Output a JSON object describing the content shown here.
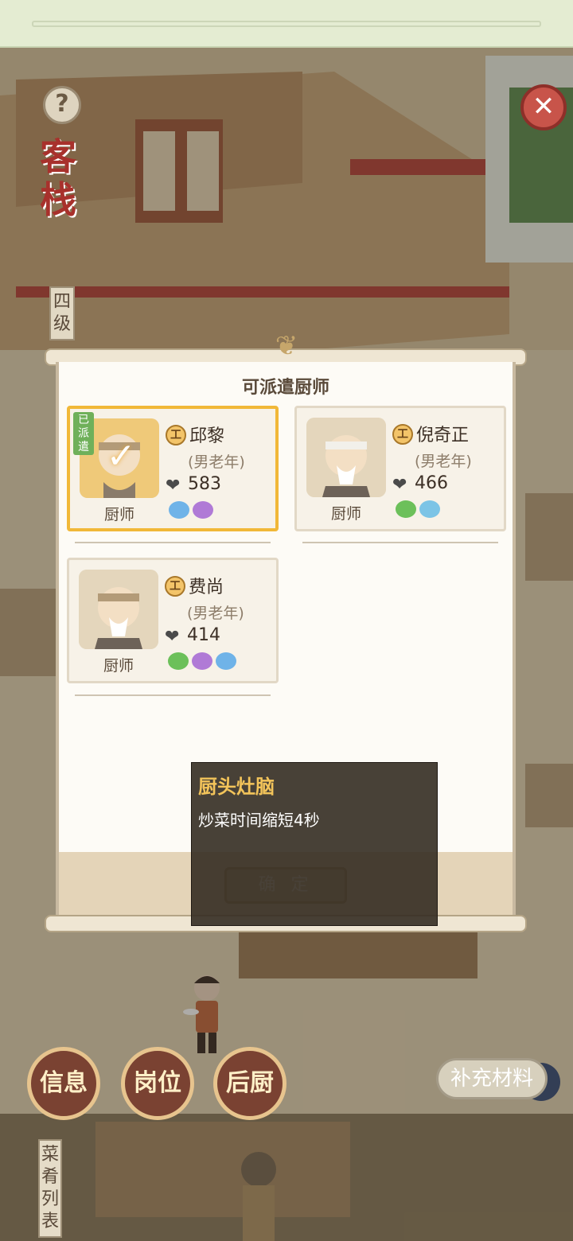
{
  "hud": {
    "help_symbol": "?",
    "close_symbol": "✕",
    "inn_title": "客栈",
    "inn_level": "四级",
    "buttons": {
      "info": "信息",
      "position": "岗位",
      "kitchen": "后厨"
    },
    "supply_button": "补充材料",
    "dish_list": "菜肴列表"
  },
  "dialog": {
    "title": "可派遣厨师",
    "confirm_label": "确 定",
    "chefs": [
      {
        "name": "邱黎",
        "profile": "(男老年)",
        "job": "厨师",
        "score": "583",
        "badge": "工",
        "dispatched_label": "已派遣",
        "selected": true,
        "skill_colors": [
          "#6fb3e8",
          "#b07ad6"
        ]
      },
      {
        "name": "倪奇正",
        "profile": "(男老年)",
        "job": "厨师",
        "score": "466",
        "badge": "工",
        "selected": false,
        "skill_colors": [
          "#6cc05a",
          "#7cc4e6"
        ]
      },
      {
        "name": "费尚",
        "profile": "(男老年)",
        "job": "厨师",
        "score": "414",
        "badge": "工",
        "selected": false,
        "skill_colors": [
          "#6cc05a",
          "#b07ad6",
          "#6fb3e8"
        ]
      }
    ]
  },
  "tooltip": {
    "title": "厨头灶脑",
    "description": "炒菜时间缩短4秒"
  }
}
